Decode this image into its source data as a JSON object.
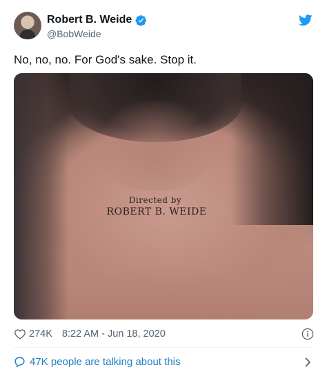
{
  "author": {
    "name": "Robert B. Weide",
    "handle": "@BobWeide"
  },
  "tweet": {
    "text": "No, no, no. For God's sake. Stop it."
  },
  "photo": {
    "tattoo_line1": "Directed by",
    "tattoo_line2": "ROBERT B. WEIDE"
  },
  "meta": {
    "likes": "274K",
    "timestamp": "8:22 AM - Jun 18, 2020"
  },
  "conversation": {
    "label": "47K people are talking about this"
  },
  "colors": {
    "accent": "#1d9bf0",
    "link": "#1d7fc4",
    "muted": "#536471"
  },
  "icons": [
    "verified-badge-icon",
    "twitter-bird-icon",
    "heart-icon",
    "info-icon",
    "speech-bubble-icon",
    "chevron-right-icon"
  ]
}
